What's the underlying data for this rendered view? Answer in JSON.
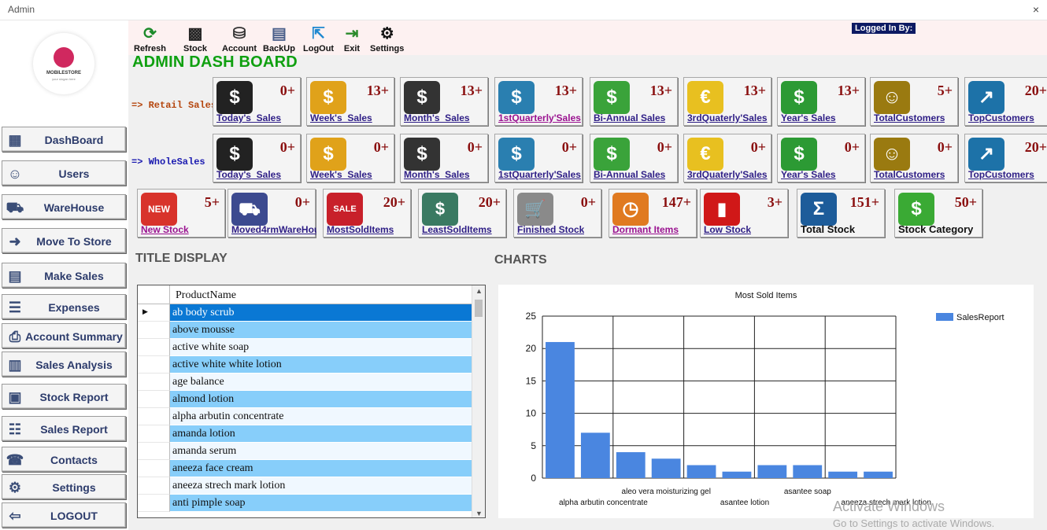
{
  "window": {
    "title": "Admin",
    "close": "×"
  },
  "logo": {
    "name": "MOBILESTORE",
    "tagline": "your slogan here"
  },
  "nav": [
    {
      "label": "DashBoard",
      "icon": "computer-icon"
    },
    {
      "label": "Users",
      "icon": "user-icon"
    },
    {
      "label": "WareHouse",
      "icon": "trolley-icon"
    },
    {
      "label": "Move To Store",
      "icon": "move-icon"
    },
    {
      "label": "Make Sales",
      "icon": "sales-icon"
    },
    {
      "label": "Expenses",
      "icon": "receipt-icon"
    },
    {
      "label": "Account Summary",
      "icon": "printer-icon"
    },
    {
      "label": "Sales Analysis",
      "icon": "bar-chart-icon"
    },
    {
      "label": "Stock Report",
      "icon": "stock-report-icon"
    },
    {
      "label": "Sales Report",
      "icon": "report-icon"
    },
    {
      "label": "Contacts",
      "icon": "phone-icon"
    },
    {
      "label": "Settings",
      "icon": "gear-icon"
    },
    {
      "label": "LOGOUT",
      "icon": "logout-icon"
    }
  ],
  "toolbar": [
    {
      "label": "Refresh",
      "icon": "refresh-icon"
    },
    {
      "label": "Stock",
      "icon": "stock-icon"
    },
    {
      "label": "Account",
      "icon": "account-icon"
    },
    {
      "label": "BackUp",
      "icon": "backup-icon"
    },
    {
      "label": "LogOut",
      "icon": "logout-icon"
    },
    {
      "label": "Exit",
      "icon": "exit-icon"
    },
    {
      "label": "Settings",
      "icon": "gear-icon"
    }
  ],
  "logged_in_label": "Logged In By:",
  "dashboard_title": "ADMIN DASH BOARD",
  "retail": {
    "label": "=> Retail Sales",
    "tiles": [
      {
        "label": "Today's_Sales",
        "count": "0+"
      },
      {
        "label": "Week's_Sales",
        "count": "13+"
      },
      {
        "label": "Month's_Sales",
        "count": "13+"
      },
      {
        "label": "1stQuarterly'Sales",
        "count": "13+"
      },
      {
        "label": "Bi-Annual Sales",
        "count": "13+"
      },
      {
        "label": "3rdQuaterly'Sales",
        "count": "13+"
      },
      {
        "label": "Year's Sales",
        "count": "13+"
      },
      {
        "label": "TotalCustomers",
        "count": "5+"
      },
      {
        "label": "TopCustomers",
        "count": "20+"
      }
    ]
  },
  "wholesale": {
    "label": "=> WholeSales",
    "tiles": [
      {
        "label": "Today's_Sales",
        "count": "0+"
      },
      {
        "label": "Week's_Sales",
        "count": "0+"
      },
      {
        "label": "Month's_Sales",
        "count": "0+"
      },
      {
        "label": "1stQuarterly'Sales",
        "count": "0+"
      },
      {
        "label": "Bi-Annual Sales",
        "count": "0+"
      },
      {
        "label": "3rdQuaterly'Sales",
        "count": "0+"
      },
      {
        "label": "Year's Sales",
        "count": "0+"
      },
      {
        "label": "TotalCustomers",
        "count": "0+"
      },
      {
        "label": "TopCustomers",
        "count": "20+"
      }
    ]
  },
  "stock_tiles": [
    {
      "label": "New Stock",
      "count": "5+"
    },
    {
      "label": "Moved4rmWareHous",
      "count": "0+"
    },
    {
      "label": "MostSoldItems",
      "count": "20+"
    },
    {
      "label": "LeastSoldItems",
      "count": "20+"
    },
    {
      "label": "Finished Stock",
      "count": "0+"
    },
    {
      "label": "Dormant Items",
      "count": "147+"
    },
    {
      "label": "Low Stock",
      "count": "3+"
    },
    {
      "label": "Total Stock",
      "count": "151+"
    },
    {
      "label": "Stock Category",
      "count": "50+"
    }
  ],
  "title_display": "TITLE DISPLAY",
  "charts_heading": "CHARTS",
  "grid": {
    "column": "ProductName",
    "rows": [
      "ab body scrub",
      "above mousse",
      "active white soap",
      "active white white lotion",
      "age balance",
      "almond lotion",
      "alpha arbutin concentrate",
      "amanda lotion",
      "amanda serum",
      "aneeza face cream",
      "aneeza strech mark lotion",
      "anti pimple soap"
    ]
  },
  "chart_data": {
    "type": "bar",
    "title": "Most Sold Items",
    "xlabel": "",
    "ylabel": "",
    "ylim": [
      0,
      25
    ],
    "yticks": [
      0,
      5,
      10,
      15,
      20,
      25
    ],
    "grid": true,
    "legend_position": "top-right",
    "categories": [
      "alpha arbutin concentrate",
      "",
      "aleo vera moisturizing gel",
      "",
      "asantee lotion",
      "",
      "asantee soap",
      "",
      "aneeza strech mark lotion",
      ""
    ],
    "series": [
      {
        "name": "SalesReport",
        "color": "#4a86e0",
        "values": [
          21,
          7,
          4,
          3,
          2,
          1,
          2,
          2,
          1,
          1
        ]
      }
    ]
  },
  "watermark": {
    "line1": "Activate Windows",
    "line2": "Go to Settings to activate Windows."
  }
}
